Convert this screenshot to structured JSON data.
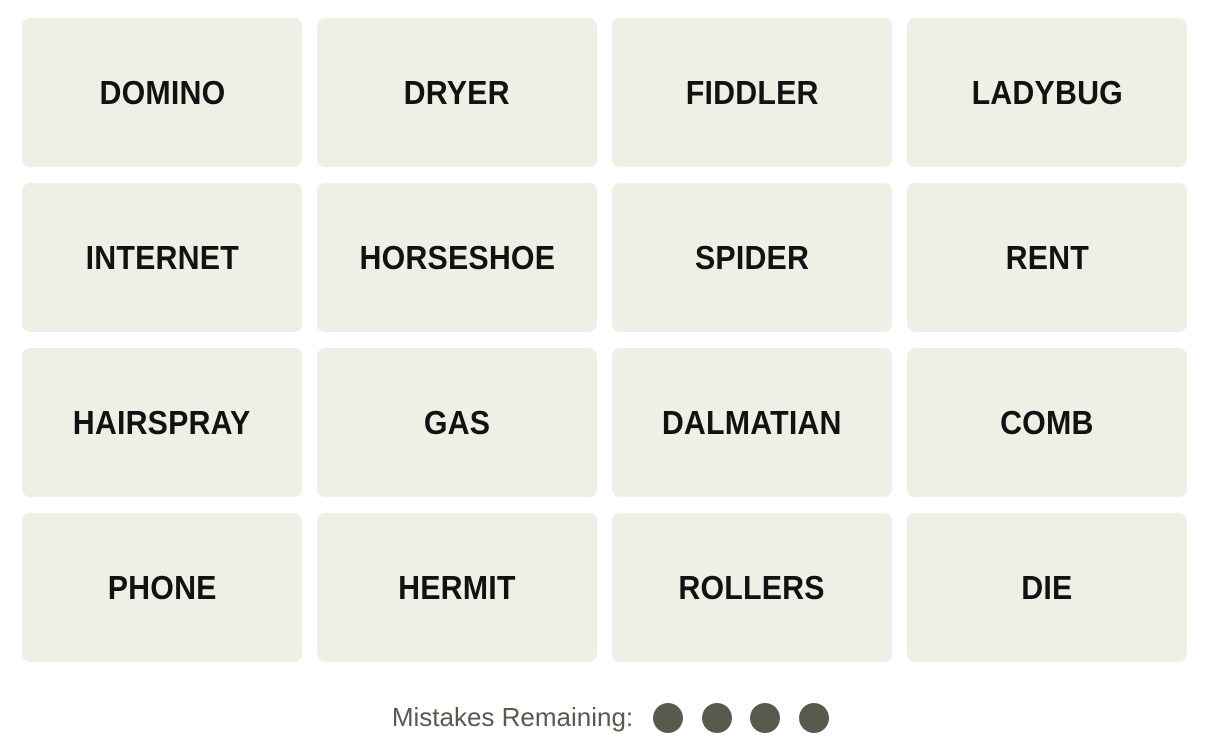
{
  "board": {
    "tiles": [
      "DOMINO",
      "DRYER",
      "FIDDLER",
      "LADYBUG",
      "INTERNET",
      "HORSESHOE",
      "SPIDER",
      "RENT",
      "HAIRSPRAY",
      "GAS",
      "DALMATIAN",
      "COMB",
      "PHONE",
      "HERMIT",
      "ROLLERS",
      "DIE"
    ]
  },
  "status": {
    "mistakes_label": "Mistakes Remaining:",
    "mistakes_remaining": 4,
    "dot_color": "#5a594e"
  },
  "colors": {
    "tile_bg": "#efefe6",
    "tile_text": "#121212"
  }
}
